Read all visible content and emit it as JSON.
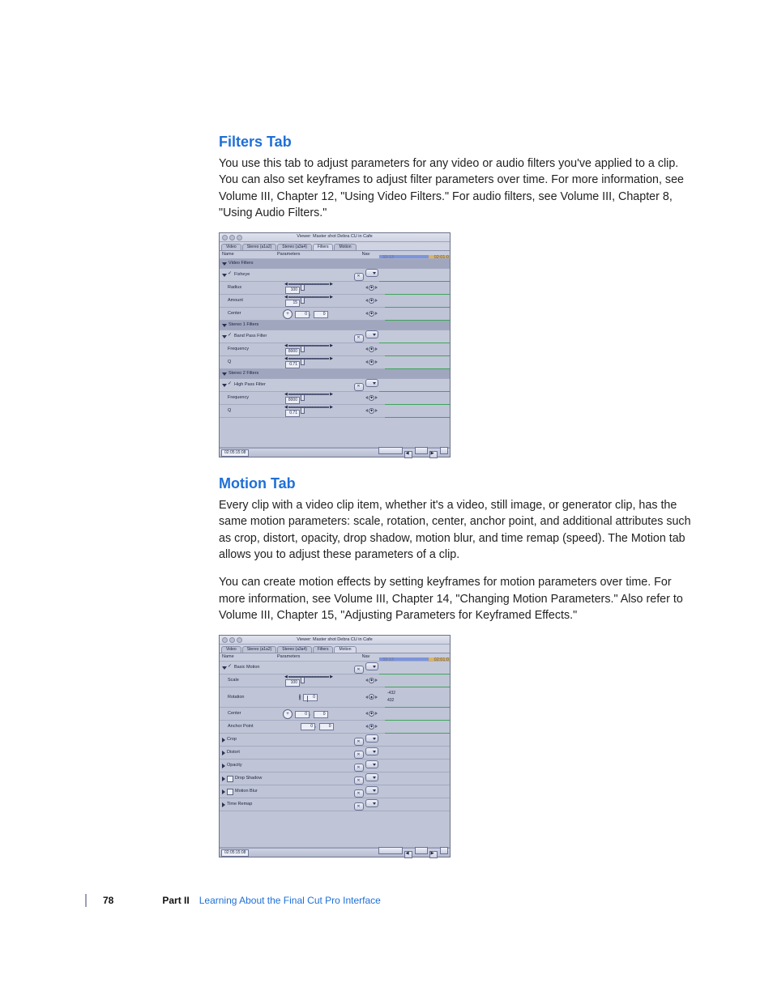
{
  "section1": {
    "heading": "Filters Tab",
    "para": "You use this tab to adjust parameters for any video or audio filters you've applied to a clip. You can also set keyframes to adjust filter parameters over time. For more information, see Volume III, Chapter 12, \"Using Video Filters.\" For audio filters, see Volume III, Chapter 8, \"Using Audio Filters.\""
  },
  "section2": {
    "heading": "Motion Tab",
    "para1": "Every clip with a video clip item, whether it's a video, still image, or generator clip, has the same motion parameters: scale, rotation, center, anchor point, and additional attributes such as crop, distort, opacity, drop shadow, motion blur, and time remap (speed). The Motion tab allows you to adjust these parameters of a clip.",
    "para2": "You can create motion effects by setting keyframes for motion parameters over time. For more information, see Volume III, Chapter 14, \"Changing Motion Parameters.\" Also refer to Volume III, Chapter 15, \"Adjusting Parameters for Keyframed Effects.\""
  },
  "viewer_common": {
    "window_title": "Viewer: Master shot Debra CU in Cafe",
    "tabs": [
      "Video",
      "Stereo (a1a2)",
      "Stereo (a3a4)",
      "Filters",
      "Motion"
    ],
    "cols": {
      "name": "Name",
      "params": "Parameters",
      "nav": "Nav"
    },
    "ruler_hint": "33:13",
    "ruler_end": "02:01:0",
    "timecode": "02:05:15:08"
  },
  "filters_panel": {
    "active_tab_index": 3,
    "groups": [
      {
        "label": "Video Filters",
        "type": "header"
      },
      {
        "label": "Fisheye",
        "type": "filter",
        "reset": true,
        "params": [
          {
            "name": "Radius",
            "control": "slider",
            "value": "100"
          },
          {
            "name": "Amount",
            "control": "slider",
            "value": "15"
          },
          {
            "name": "Center",
            "control": "center",
            "x": "0",
            "y": "0"
          }
        ]
      },
      {
        "label": "Stereo 1 Filters",
        "type": "header"
      },
      {
        "label": "Band Pass Filter",
        "type": "filter",
        "reset": true,
        "params": [
          {
            "name": "Frequency",
            "control": "slider",
            "value": "8000"
          },
          {
            "name": "Q",
            "control": "slider",
            "value": "0.71"
          }
        ]
      },
      {
        "label": "Stereo 2 Filters",
        "type": "header"
      },
      {
        "label": "High Pass Filter",
        "type": "filter",
        "reset": true,
        "params": [
          {
            "name": "Frequency",
            "control": "slider",
            "value": "8000"
          },
          {
            "name": "Q",
            "control": "slider",
            "value": "0.71"
          }
        ]
      }
    ]
  },
  "motion_panel": {
    "active_tab_index": 4,
    "groups": [
      {
        "label": "Basic Motion",
        "type": "filter",
        "reset": true,
        "open": true,
        "params": [
          {
            "name": "Scale",
            "control": "slider",
            "value": "100"
          },
          {
            "name": "Rotation",
            "control": "rotation",
            "value": "0",
            "tl_vals": [
              "432",
              "-432"
            ]
          },
          {
            "name": "Center",
            "control": "center",
            "x": "0",
            "y": "0"
          },
          {
            "name": "Anchor Point",
            "control": "xy",
            "x": "0",
            "y": "0"
          }
        ]
      },
      {
        "label": "Crop",
        "type": "filter_closed",
        "reset": true
      },
      {
        "label": "Distort",
        "type": "filter_closed",
        "reset": true
      },
      {
        "label": "Opacity",
        "type": "filter_closed",
        "reset": true
      },
      {
        "label": "Drop Shadow",
        "type": "filter_closed",
        "reset": true,
        "checkbox": true
      },
      {
        "label": "Motion Blur",
        "type": "filter_closed",
        "reset": true,
        "checkbox": true
      },
      {
        "label": "Time Remap",
        "type": "filter_closed",
        "reset": true
      }
    ]
  },
  "footer": {
    "page": "78",
    "part": "Part II",
    "title": "Learning About the Final Cut Pro Interface"
  }
}
